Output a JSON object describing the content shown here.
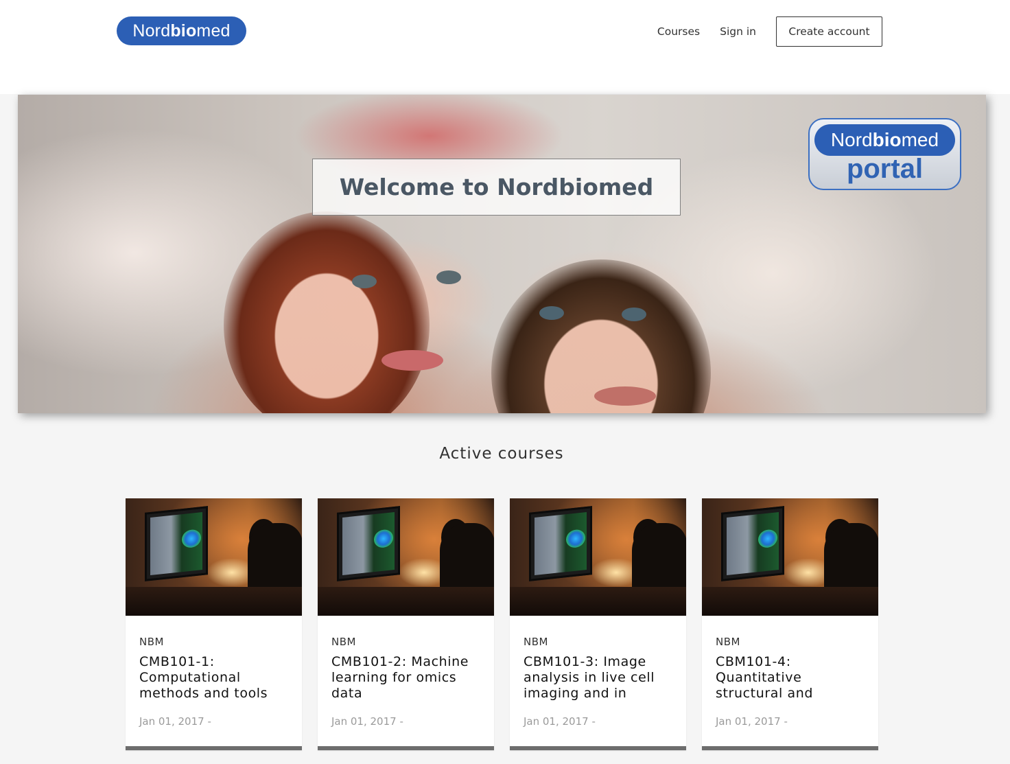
{
  "header": {
    "logo": {
      "prefix": "Nord",
      "bold": "bio",
      "suffix": "med"
    },
    "nav": {
      "courses_label": "Courses",
      "signin_label": "Sign in",
      "create_account_label": "Create account"
    }
  },
  "hero": {
    "title": "Welcome to Nordbiomed",
    "portal_logo": {
      "prefix": "Nord",
      "bold": "bio",
      "suffix": "med",
      "subtitle": "portal"
    }
  },
  "courses_section": {
    "title": "Active courses",
    "cards": [
      {
        "org": "NBM",
        "title": "CMB101-1: Computational methods and tools",
        "date": "Jan 01, 2017 -"
      },
      {
        "org": "NBM",
        "title": "CMB101-2: Machine learning for omics data",
        "date": "Jan 01, 2017 -"
      },
      {
        "org": "NBM",
        "title": "CBM101-3: Image analysis in live cell imaging and in",
        "date": "Jan 01, 2017 -"
      },
      {
        "org": "NBM",
        "title": "CBM101-4: Quantitative structural and",
        "date": "Jan 01, 2017 -"
      }
    ]
  },
  "colors": {
    "brand_blue": "#2c5fb5",
    "page_bg": "#f5f5f5",
    "card_border": "#6d6d6d"
  }
}
